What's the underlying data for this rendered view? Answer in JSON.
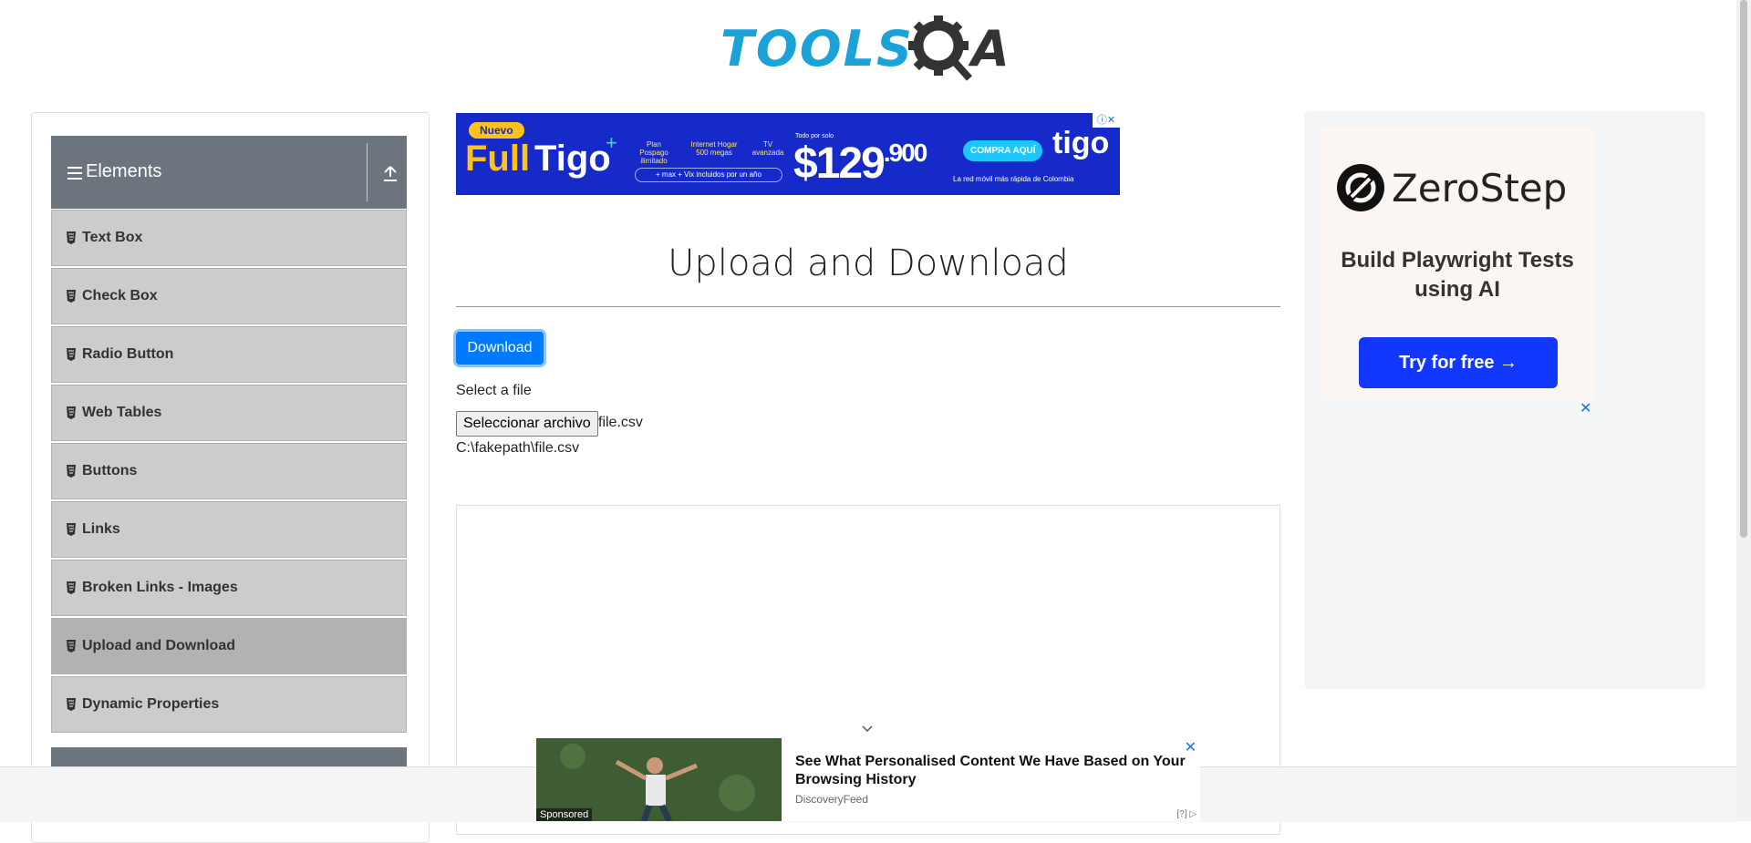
{
  "header": {
    "logo_text": "TOOLS",
    "logo_suffix": "A"
  },
  "sidebar": {
    "group_title": "Elements",
    "items": [
      {
        "label": "Text Box"
      },
      {
        "label": "Check Box"
      },
      {
        "label": "Radio Button"
      },
      {
        "label": "Web Tables"
      },
      {
        "label": "Buttons"
      },
      {
        "label": "Links"
      },
      {
        "label": "Broken Links - Images"
      },
      {
        "label": "Upload and Download",
        "active": true
      },
      {
        "label": "Dynamic Properties"
      }
    ]
  },
  "top_ad": {
    "badge": "Nuevo",
    "headline_a": "Full",
    "headline_b": "Tigo",
    "plus": "+",
    "feature_1": "Plan Pospago ilimitado",
    "feature_2": "Internet Hogar 500 megas",
    "feature_3": "TV avanzada",
    "bundle": "+ max + Vix incluidos por un año",
    "price_prefix": "Todo por solo",
    "price": "$129",
    "price_cents": ".900",
    "cta": "COMPRA AQUÍ",
    "brand": "tigo",
    "tagline": "La red móvil más rápida de Colombia",
    "close": "ⓘ✕"
  },
  "main": {
    "title": "Upload and Download",
    "download_label": "Download",
    "select_label": "Select a file",
    "file_button": "Seleccionar archivo",
    "file_name": "file.csv",
    "file_path": "C:\\fakepath\\file.csv"
  },
  "right_ad": {
    "brand": "ZeroStep",
    "headline": "Build Playwright Tests using AI",
    "cta": "Try for free →",
    "close": "✕"
  },
  "bottom_ad": {
    "sponsored": "Sponsored",
    "headline": "See What Personalised Content We Have Based on Your Browsing History",
    "source": "DiscoveryFeed",
    "close": "✕",
    "adchoices": "[?]"
  },
  "colors": {
    "accent": "#007bff",
    "logo_blue": "#1ba2d9",
    "sidebar_header": "#6c757d",
    "menu_item": "#cccccc"
  }
}
